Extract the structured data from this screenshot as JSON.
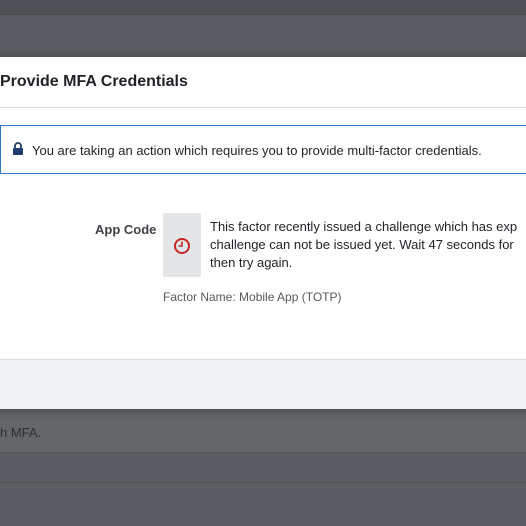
{
  "background": {
    "text": "h MFA."
  },
  "modal": {
    "title": "Provide MFA Credentials",
    "notice": {
      "icon": "lock-icon",
      "text": "You are taking an action which requires you to provide multi-factor credentials."
    },
    "field": {
      "label": "App Code",
      "icon": "clock-icon",
      "message_lines": [
        "This factor recently issued a challenge which has exp",
        "challenge can not be issued yet. Wait 47 seconds for",
        "then try again."
      ],
      "factor_name": "Factor Name: Mobile App (TOTP)"
    }
  },
  "colors": {
    "notice_border": "#2f7bbf",
    "clock_icon": "#c62828",
    "lock_icon": "#1f3d6b"
  }
}
